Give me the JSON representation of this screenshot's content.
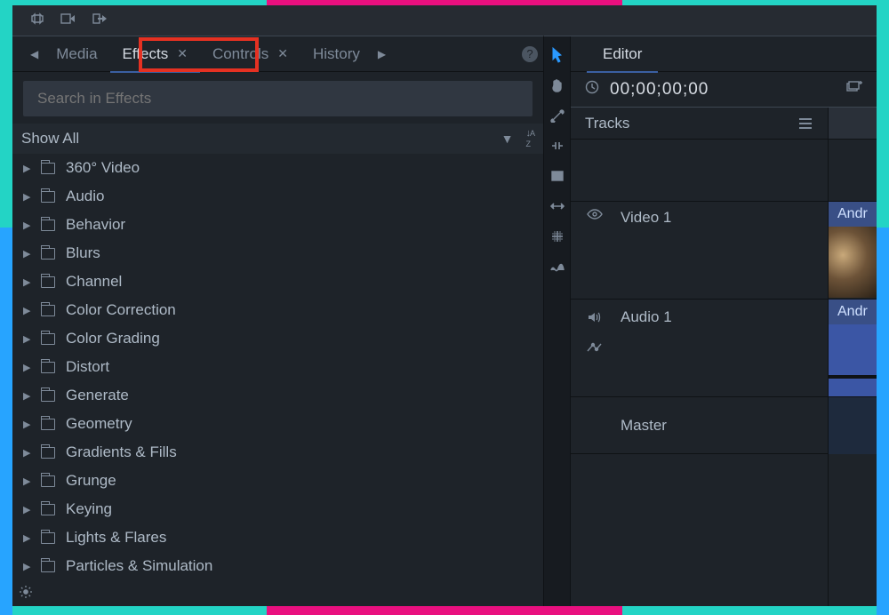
{
  "titlebar": {
    "icons": [
      "loop",
      "export",
      "share"
    ]
  },
  "tabs": [
    {
      "label": "Media",
      "closable": false,
      "active": false
    },
    {
      "label": "Effects",
      "closable": true,
      "active": true
    },
    {
      "label": "Controls",
      "closable": true,
      "active": false
    },
    {
      "label": "History",
      "closable": false,
      "active": false
    }
  ],
  "search": {
    "placeholder": "Search in Effects",
    "value": ""
  },
  "filter": {
    "label": "Show All"
  },
  "effects": [
    "360° Video",
    "Audio",
    "Behavior",
    "Blurs",
    "Channel",
    "Color Correction",
    "Color Grading",
    "Distort",
    "Generate",
    "Geometry",
    "Gradients & Fills",
    "Grunge",
    "Keying",
    "Lights & Flares",
    "Particles & Simulation"
  ],
  "editor": {
    "tab": "Editor",
    "timecode": "00;00;00;00",
    "tracks_label": "Tracks",
    "video_track": "Video 1",
    "audio_track": "Audio 1",
    "master_track": "Master",
    "clip_video": "Andr",
    "clip_audio": "Andr"
  }
}
